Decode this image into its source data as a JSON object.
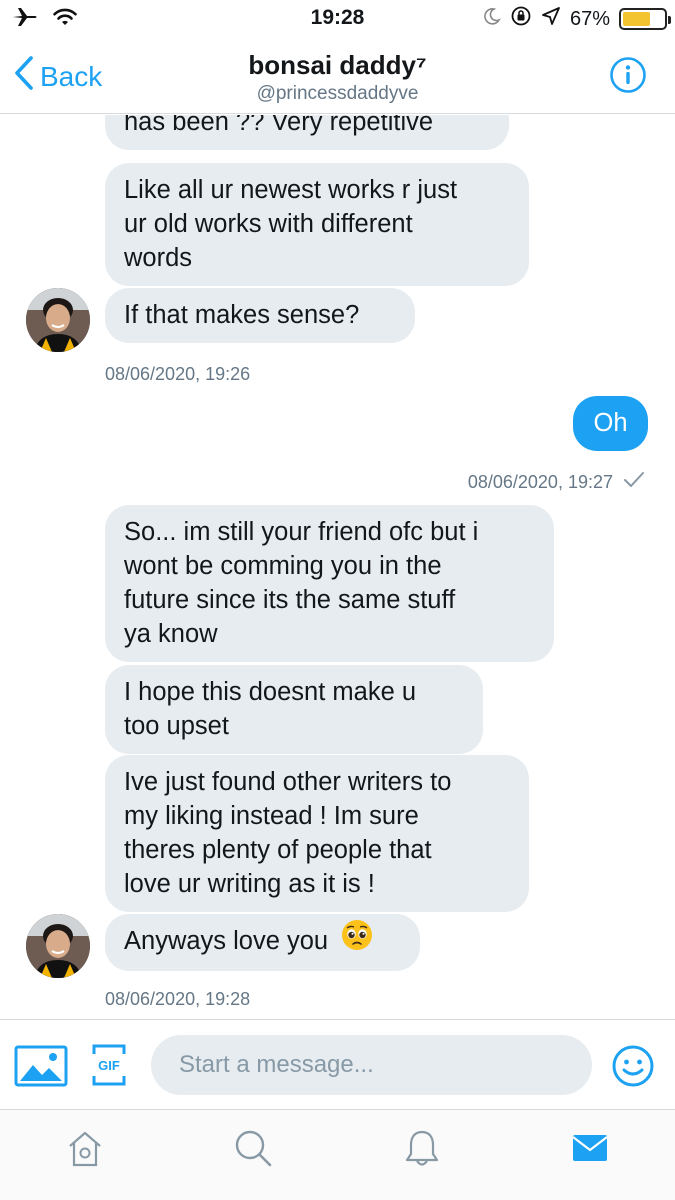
{
  "status_bar": {
    "time": "19:28",
    "battery_percent": "67%",
    "battery_level": 0.67,
    "icons": [
      "airplane-icon",
      "wifi-icon",
      "moon-icon",
      "orientation-lock-icon",
      "location-icon",
      "battery-icon"
    ]
  },
  "header": {
    "back_label": "Back",
    "title": "bonsai daddy⁷",
    "handle": "@princessdaddyve",
    "info_icon": "info-icon"
  },
  "messages": [
    {
      "sender": "them",
      "lines": [
        "has been ?? Very repetitive"
      ]
    },
    {
      "sender": "them",
      "lines": [
        "Like all ur newest works r just",
        "ur old works with different",
        "words"
      ]
    },
    {
      "sender": "them",
      "lines": [
        "If that makes sense?"
      ]
    },
    {
      "sender": "me",
      "lines": [
        "Oh"
      ]
    },
    {
      "sender": "them",
      "lines": [
        "So... im still your friend ofc but i",
        "wont be comming you in the",
        "future since its the same stuff",
        "ya know"
      ]
    },
    {
      "sender": "them",
      "lines": [
        "I hope this doesnt make u",
        "too upset"
      ]
    },
    {
      "sender": "them",
      "lines": [
        "Ive just found other writers to",
        "my liking instead ! Im sure",
        "theres plenty of people that",
        "love ur writing as it is !"
      ]
    },
    {
      "sender": "them",
      "lines": [
        "Anyways love you"
      ],
      "emoji": "pleading-face-emoji"
    }
  ],
  "timestamps": {
    "first": "08/06/2020, 19:26",
    "mine": "08/06/2020, 19:27",
    "last": "08/06/2020, 19:28"
  },
  "composer": {
    "placeholder": "Start a message...",
    "gif_label": "GIF"
  },
  "tabs": [
    {
      "name": "home",
      "icon": "home-icon",
      "active": false
    },
    {
      "name": "search",
      "icon": "search-icon",
      "active": false
    },
    {
      "name": "notifications",
      "icon": "bell-icon",
      "active": false
    },
    {
      "name": "messages",
      "icon": "mail-icon",
      "active": true
    }
  ],
  "colors": {
    "accent": "#1da1f2",
    "bubble_them": "#e6ecf0",
    "timestamp": "#657786",
    "battery": "#f4c430"
  }
}
